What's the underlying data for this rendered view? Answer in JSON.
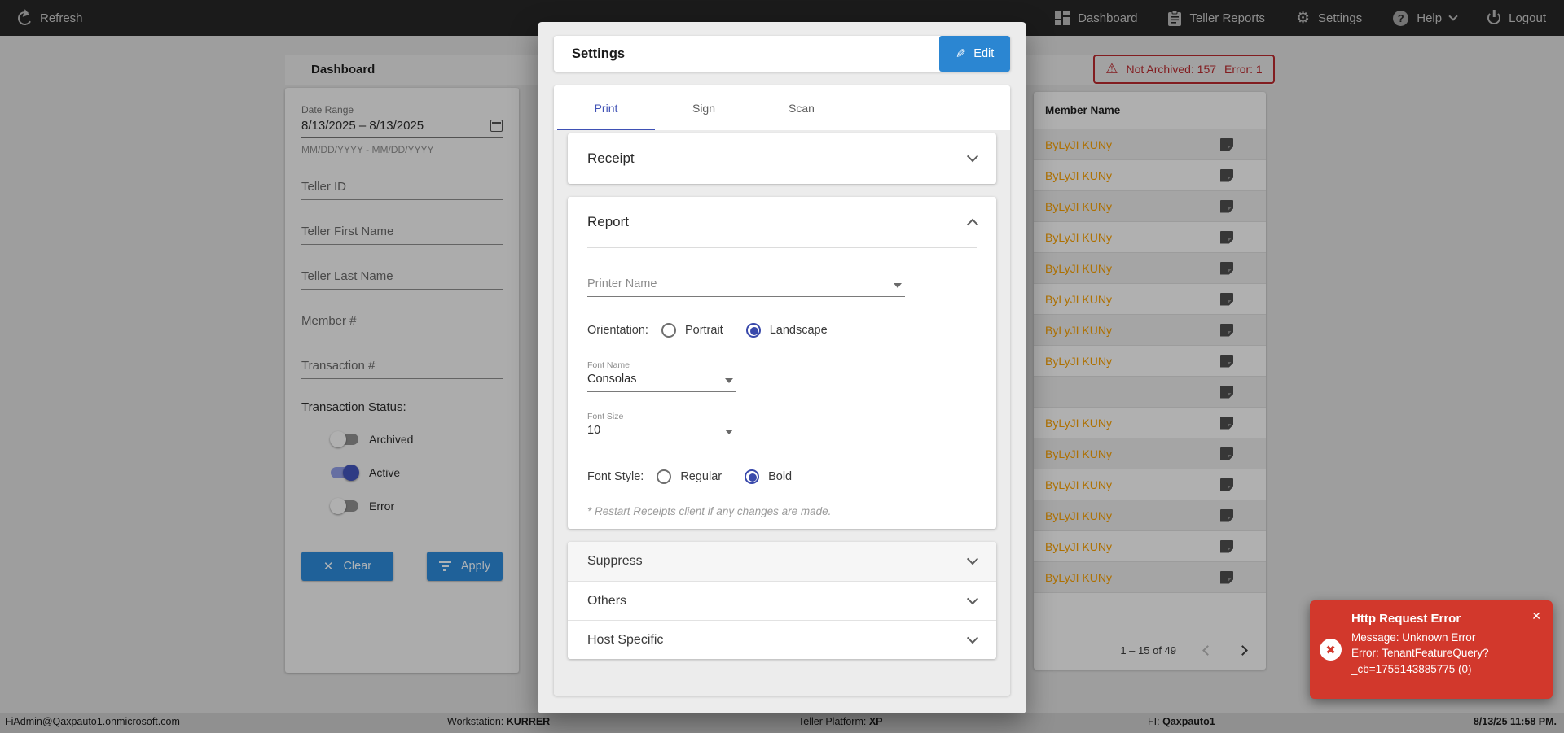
{
  "colors": {
    "accent": "#3f51b5",
    "button_blue": "#2b86d2",
    "error_red": "#b3282d",
    "toast_red": "#d2382c",
    "member_orange": "#ef9a00"
  },
  "topnav": {
    "refresh_label": "Refresh",
    "items": [
      {
        "label": "Dashboard",
        "icon": "dashboard-icon"
      },
      {
        "label": "Teller Reports",
        "icon": "clipboard-icon"
      },
      {
        "label": "Settings",
        "icon": "gear-icon"
      },
      {
        "label": "Help",
        "icon": "help-icon"
      },
      {
        "label": "Logout",
        "icon": "power-icon"
      }
    ],
    "gear_glyph": "⚙",
    "help_glyph": "?"
  },
  "page": {
    "title": "Dashboard"
  },
  "error_badge": {
    "warning_glyph": "⚠",
    "not_archived": "Not Archived: 157",
    "error": "Error: 1"
  },
  "filters": {
    "date_range_label": "Date Range",
    "date_range_value": "8/13/2025 – 8/13/2025",
    "date_range_hint": "MM/DD/YYYY - MM/DD/YYYY",
    "fields": [
      "Teller ID",
      "Teller First Name",
      "Teller Last Name",
      "Member #",
      "Transaction #"
    ],
    "status_label": "Transaction Status:",
    "toggles": [
      {
        "label": "Archived",
        "on": false
      },
      {
        "label": "Active",
        "on": true
      },
      {
        "label": "Error",
        "on": false
      }
    ],
    "clear_label": "Clear",
    "clear_glyph": "✕",
    "apply_label": "Apply"
  },
  "table": {
    "header": "Member Name",
    "rows": [
      {
        "name": "ByLyJI KUNy"
      },
      {
        "name": "ByLyJI KUNy"
      },
      {
        "name": "ByLyJI KUNy"
      },
      {
        "name": "ByLyJI KUNy"
      },
      {
        "name": "ByLyJI KUNy"
      },
      {
        "name": "ByLyJI KUNy"
      },
      {
        "name": "ByLyJI KUNy"
      },
      {
        "name": "ByLyJI KUNy"
      },
      {
        "name": ""
      },
      {
        "name": "ByLyJI KUNy"
      },
      {
        "name": "ByLyJI KUNy"
      },
      {
        "name": "ByLyJI KUNy"
      },
      {
        "name": "ByLyJI KUNy"
      },
      {
        "name": "ByLyJI KUNy"
      },
      {
        "name": "ByLyJI KUNy"
      }
    ],
    "pagination": "1 – 15 of 49"
  },
  "modal": {
    "title": "Settings",
    "edit_label": "Edit",
    "edit_glyph": "✎",
    "tabs": [
      {
        "label": "Print",
        "active": true
      },
      {
        "label": "Sign",
        "active": false
      },
      {
        "label": "Scan",
        "active": false
      }
    ],
    "accordions": {
      "receipt": "Receipt",
      "report": "Report",
      "suppress": "Suppress",
      "others": "Others",
      "host_specific": "Host Specific"
    },
    "report": {
      "printer_placeholder": "Printer Name",
      "orientation_label": "Orientation:",
      "orientation_options": [
        "Portrait",
        "Landscape"
      ],
      "orientation_selected": "Landscape",
      "font_name_label": "Font Name",
      "font_name_value": "Consolas",
      "font_size_label": "Font Size",
      "font_size_value": "10",
      "font_style_label": "Font Style:",
      "font_style_options": [
        "Regular",
        "Bold"
      ],
      "font_style_selected": "Bold",
      "note": "* Restart Receipts client if any changes are made."
    }
  },
  "toast": {
    "title": "Http Request Error",
    "lines": [
      "Message: Unknown Error",
      "Error: TenantFeatureQuery?",
      "_cb=1755143885775 (0)"
    ],
    "error_glyph": "✖",
    "close_glyph": "✕"
  },
  "statusbar": {
    "user": "FiAdmin@Qaxpauto1.onmicrosoft.com",
    "workstation_label": "Workstation:",
    "workstation_value": "KURRER",
    "platform_label": "Teller Platform:",
    "platform_value": "XP",
    "fi_label": "FI:",
    "fi_value": "Qaxpauto1",
    "timestamp": "8/13/25 11:58 PM."
  }
}
